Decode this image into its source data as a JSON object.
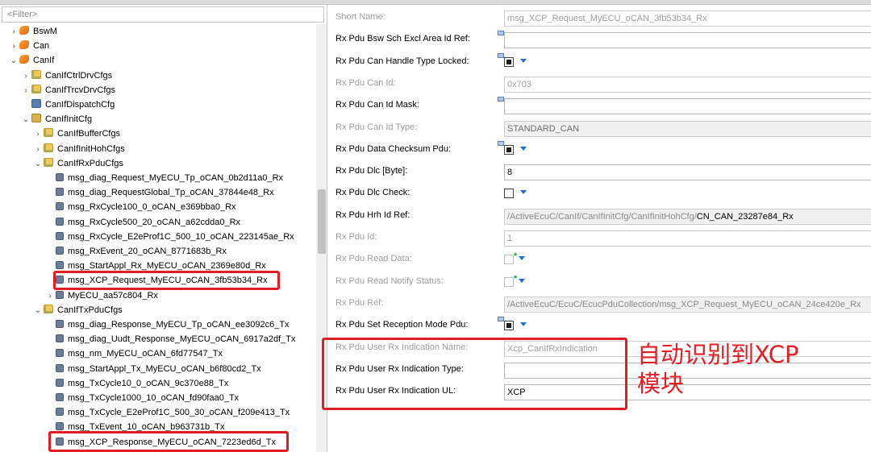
{
  "filter": {
    "placeholder": "<Filter>"
  },
  "tree": [
    {
      "label": "BswM",
      "icon": "module-icon",
      "arrow": ">",
      "indent": 0
    },
    {
      "label": "Can",
      "icon": "module-icon",
      "arrow": ">",
      "indent": 0
    },
    {
      "label": "CanIf",
      "icon": "module-icon",
      "arrow": "v",
      "indent": 0
    },
    {
      "label": "CanIfCtrlDrvCfgs",
      "icon": "folder-icon",
      "arrow": ">",
      "indent": 1
    },
    {
      "label": "CanIfTrcvDrvCfgs",
      "icon": "folder-icon",
      "arrow": ">",
      "indent": 1
    },
    {
      "label": "CanIfDispatchCfg",
      "icon": "config-icon",
      "arrow": "",
      "indent": 1
    },
    {
      "label": "CanIfInitCfg",
      "icon": "init-icon",
      "arrow": "v",
      "indent": 1
    },
    {
      "label": "CanIfBufferCfgs",
      "icon": "folder-icon",
      "arrow": ">",
      "indent": 2
    },
    {
      "label": "CanIfInitHohCfgs",
      "icon": "folder-icon",
      "arrow": ">",
      "indent": 2
    },
    {
      "label": "CanIfRxPduCfgs",
      "icon": "folder-icon",
      "arrow": "v",
      "indent": 2
    },
    {
      "label": "msg_diag_Request_MyECU_Tp_oCAN_0b2d11a0_Rx",
      "icon": "pdu-icon",
      "arrow": "",
      "indent": 3
    },
    {
      "label": "msg_diag_RequestGlobal_Tp_oCAN_37844e48_Rx",
      "icon": "pdu-icon",
      "arrow": "",
      "indent": 3
    },
    {
      "label": "msg_RxCycle100_0_oCAN_e369bba0_Rx",
      "icon": "pdu-icon",
      "arrow": "",
      "indent": 3
    },
    {
      "label": "msg_RxCycle500_20_oCAN_a62cdda0_Rx",
      "icon": "pdu-icon",
      "arrow": "",
      "indent": 3
    },
    {
      "label": "msg_RxCycle_E2eProf1C_500_10_oCAN_223145ae_Rx",
      "icon": "pdu-icon",
      "arrow": "",
      "indent": 3
    },
    {
      "label": "msg_RxEvent_20_oCAN_8771683b_Rx",
      "icon": "pdu-icon",
      "arrow": "",
      "indent": 3
    },
    {
      "label": "msg_StartAppl_Rx_MyECU_oCAN_2369e80d_Rx",
      "icon": "pdu-icon",
      "arrow": "",
      "indent": 3
    },
    {
      "label": "msg_XCP_Request_MyECU_oCAN_3fb53b34_Rx",
      "icon": "pdu-icon",
      "arrow": "",
      "indent": 3
    },
    {
      "label": "MyECU_aa57c804_Rx",
      "icon": "pdu-icon",
      "arrow": ">",
      "indent": 3
    },
    {
      "label": "CanIfTxPduCfgs",
      "icon": "folder-icon",
      "arrow": "v",
      "indent": 2
    },
    {
      "label": "msg_diag_Response_MyECU_Tp_oCAN_ee3092c6_Tx",
      "icon": "pdu-icon",
      "arrow": "",
      "indent": 3
    },
    {
      "label": "msg_diag_Uudt_Response_MyECU_oCAN_6917a2df_Tx",
      "icon": "pdu-icon",
      "arrow": "",
      "indent": 3
    },
    {
      "label": "msg_nm_MyECU_oCAN_6fd77547_Tx",
      "icon": "pdu-icon",
      "arrow": "",
      "indent": 3
    },
    {
      "label": "msg_StartAppl_Tx_MyECU_oCAN_b6f80cd2_Tx",
      "icon": "pdu-icon",
      "arrow": "",
      "indent": 3
    },
    {
      "label": "msg_TxCycle10_0_oCAN_9c370e88_Tx",
      "icon": "pdu-icon",
      "arrow": "",
      "indent": 3
    },
    {
      "label": "msg_TxCycle1000_10_oCAN_fd90faa0_Tx",
      "icon": "pdu-icon",
      "arrow": "",
      "indent": 3
    },
    {
      "label": "msg_TxCycle_E2eProf1C_500_30_oCAN_f209e413_Tx",
      "icon": "pdu-icon",
      "arrow": "",
      "indent": 3
    },
    {
      "label": "msg_TxEvent_10_oCAN_b963731b_Tx",
      "icon": "pdu-icon",
      "arrow": "",
      "indent": 3
    },
    {
      "label": "msg_XCP_Response_MyECU_oCAN_7223ed6d_Tx",
      "icon": "pdu-icon",
      "arrow": "",
      "indent": 3
    }
  ],
  "properties": [
    {
      "label": "Short Name:",
      "disabled": true,
      "kind": "text",
      "value": "msg_XCP_Request_MyECU_oCAN_3fb53b34_Rx",
      "ref": false
    },
    {
      "label": "Rx Pdu Bsw Sch Excl Area Id Ref:",
      "disabled": false,
      "kind": "text",
      "value": "",
      "ref": true
    },
    {
      "label": "Rx Pdu Can Handle Type Locked:",
      "disabled": false,
      "kind": "check",
      "value": "filled",
      "ref": true
    },
    {
      "label": "Rx Pdu Can Id:",
      "disabled": true,
      "kind": "text",
      "value": "0x703",
      "ref": false
    },
    {
      "label": "Rx Pdu Can Id Mask:",
      "disabled": false,
      "kind": "text",
      "value": "",
      "ref": true
    },
    {
      "label": "Rx Pdu Can Id Type:",
      "disabled": true,
      "kind": "grey",
      "value": "STANDARD_CAN",
      "ref": false
    },
    {
      "label": "Rx Pdu Data Checksum Pdu:",
      "disabled": false,
      "kind": "check",
      "value": "filled",
      "ref": true
    },
    {
      "label": "Rx Pdu Dlc [Byte]:",
      "disabled": false,
      "kind": "text",
      "value": "8",
      "ref": false
    },
    {
      "label": "Rx Pdu Dlc Check:",
      "disabled": false,
      "kind": "check",
      "value": "empty",
      "ref": false
    },
    {
      "label": "Rx Pdu Hrh Id Ref:",
      "disabled": false,
      "kind": "path",
      "value": "/ActiveEcuC/CanIf/CanIfInitCfg/CanIfInitHohCfg/",
      "value_tail": "CN_CAN_23287e84_Rx",
      "ref": false
    },
    {
      "label": "Rx Pdu Id:",
      "disabled": true,
      "kind": "text",
      "value": "1",
      "ref": false
    },
    {
      "label": "Rx Pdu Read Data:",
      "disabled": true,
      "kind": "star",
      "value": "",
      "ref": false
    },
    {
      "label": "Rx Pdu Read Notify Status:",
      "disabled": true,
      "kind": "star",
      "value": "",
      "ref": false
    },
    {
      "label": "Rx Pdu Ref:",
      "disabled": true,
      "kind": "path",
      "value": "/ActiveEcuC/EcuC/EcucPduCollection/",
      "value_tail": "msg_XCP_Request_MyECU_oCAN_24ce420e_Rx",
      "ref": false
    },
    {
      "label": "Rx Pdu Set Reception Mode Pdu:",
      "disabled": false,
      "kind": "check",
      "value": "filled",
      "ref": true
    },
    {
      "label": "Rx Pdu User Rx Indication Name:",
      "disabled": true,
      "kind": "text",
      "value": "Xcp_CanIfRxIndication",
      "ref": false
    },
    {
      "label": "Rx Pdu User Rx Indication Type:",
      "disabled": false,
      "kind": "text",
      "value": "",
      "ref": false
    },
    {
      "label": "Rx Pdu User Rx Indication UL:",
      "disabled": false,
      "kind": "text",
      "value": "XCP",
      "ref": false
    }
  ],
  "annotation": {
    "line1": "自动识别到XCP",
    "line2": "模块",
    "color": "#e21d24"
  }
}
